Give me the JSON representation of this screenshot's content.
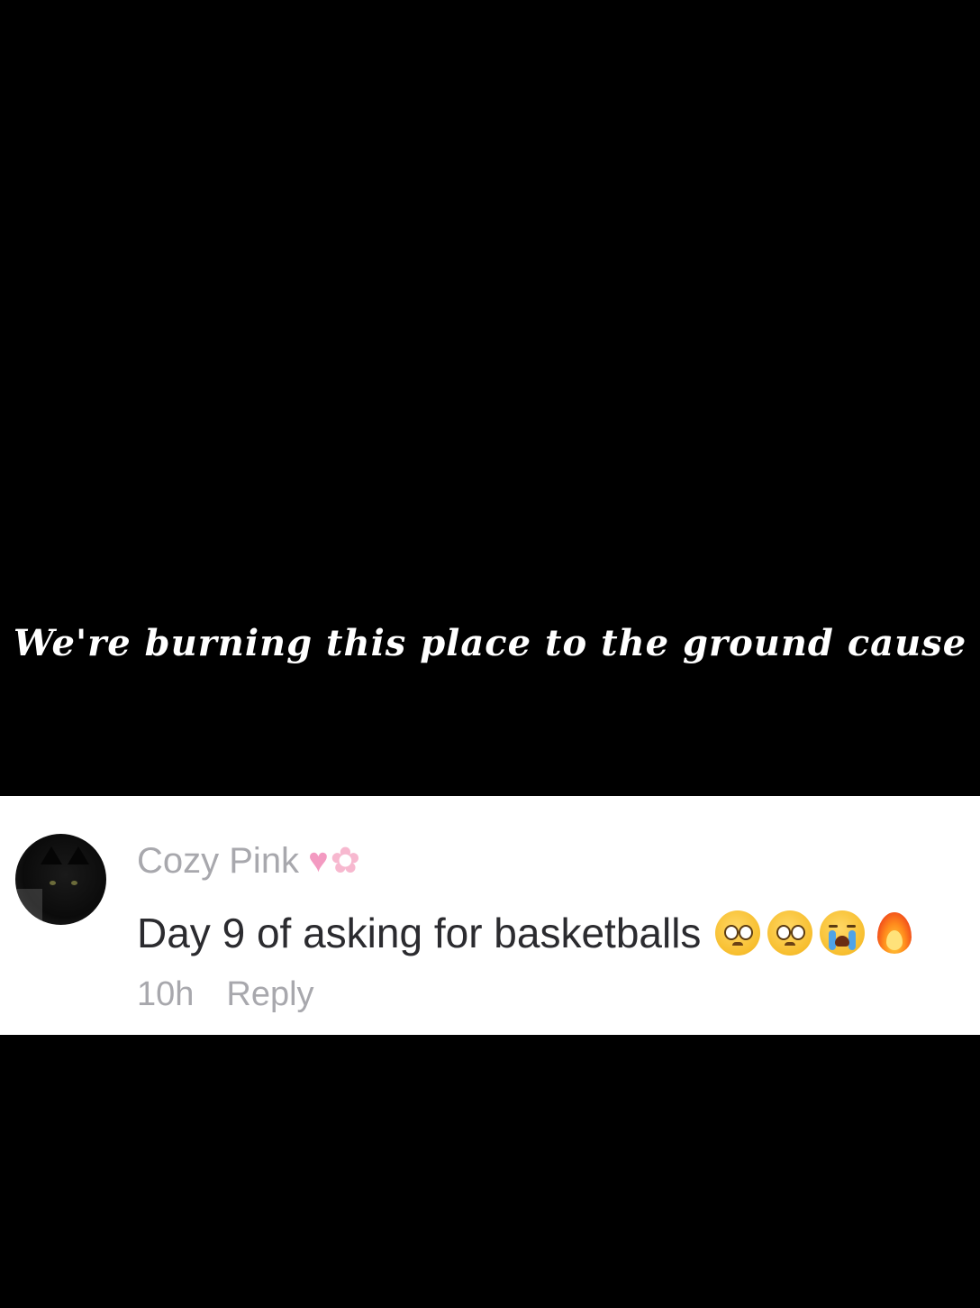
{
  "caption": {
    "text": "We're burning this place to the ground cause"
  },
  "comment": {
    "username": "Cozy Pink",
    "username_badges": [
      "heart-icon",
      "cherry-blossom-icon"
    ],
    "text": "Day 9 of asking for basketballs",
    "emojis": [
      "pleading-face-icon",
      "pleading-face-icon",
      "loudly-crying-face-icon",
      "fire-icon"
    ],
    "timestamp": "10h",
    "reply_label": "Reply"
  },
  "colors": {
    "background": "#000000",
    "card_background": "#ffffff",
    "username": "#a8a8ad",
    "comment_text": "#2b2b2f",
    "meta_text": "#a8a8ad",
    "caption_text": "#ffffff"
  }
}
